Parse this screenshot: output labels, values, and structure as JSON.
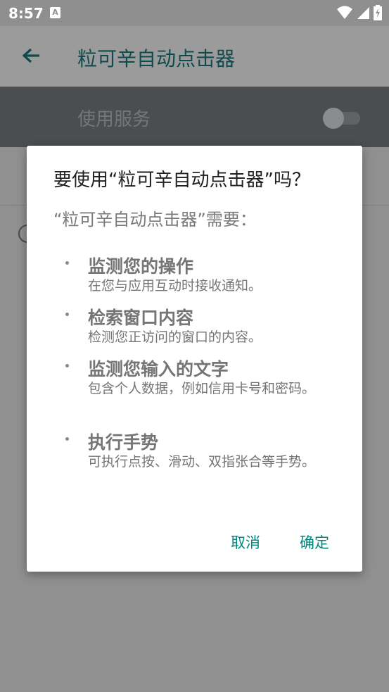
{
  "status_bar": {
    "time": "8:57",
    "notification_icon": "a-notification-icon",
    "icons": [
      "wifi-icon",
      "signal-icon",
      "battery-charging-icon"
    ]
  },
  "app_bar": {
    "back_icon": "arrow-back-icon",
    "title": "粒可辛自动点击器"
  },
  "service_row": {
    "label": "使用服务",
    "toggle_on": false
  },
  "dialog": {
    "title": "要使用“粒可辛自动点击器”吗？",
    "subtitle": "“粒可辛自动点击器”需要：",
    "permissions": [
      {
        "title": "监测您的操作",
        "desc": "在您与应用互动时接收通知。"
      },
      {
        "title": "检索窗口内容",
        "desc": "检测您正访问的窗口的内容。"
      },
      {
        "title": "监测您输入的文字",
        "desc": "包含个人数据，例如信用卡号和密码。"
      },
      {
        "title": "执行手势",
        "desc": "可执行点按、滑动、双指张合等手势。"
      }
    ],
    "cancel_label": "取消",
    "ok_label": "确定"
  },
  "colors": {
    "accent": "#00867a",
    "title_color": "#0f4b4d",
    "scrim": "#909090"
  }
}
